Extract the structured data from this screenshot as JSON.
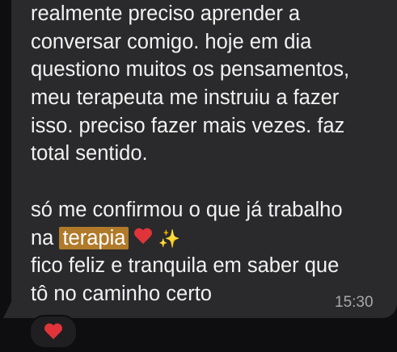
{
  "message": {
    "lines": [
      "realmente preciso aprender a",
      "conversar comigo. hoje em dia",
      "questiono muitos os pensamentos,",
      "meu terapeuta me instruiu a fazer",
      "isso. preciso fazer mais vezes. faz",
      "total sentido."
    ],
    "para2_line1": "só me confirmou o que já trabalho",
    "para2_prefix": "na",
    "highlighted_word": "terapia",
    "sparkles": "✨",
    "para2_line3": "fico feliz e tranquila em saber que",
    "para2_line4": "tô no caminho certo",
    "emoji_heart": "red-heart",
    "emoji_sparkles": "sparkles"
  },
  "timestamp": "15:30",
  "reaction": {
    "emoji": "red-heart"
  },
  "colors": {
    "background": "#0e0e10",
    "bubble": "#2a2a2c",
    "text": "#f2f2f2",
    "highlight": "#b07a2a",
    "heart": "#e0343a",
    "timestamp": "#a8a8aa"
  }
}
